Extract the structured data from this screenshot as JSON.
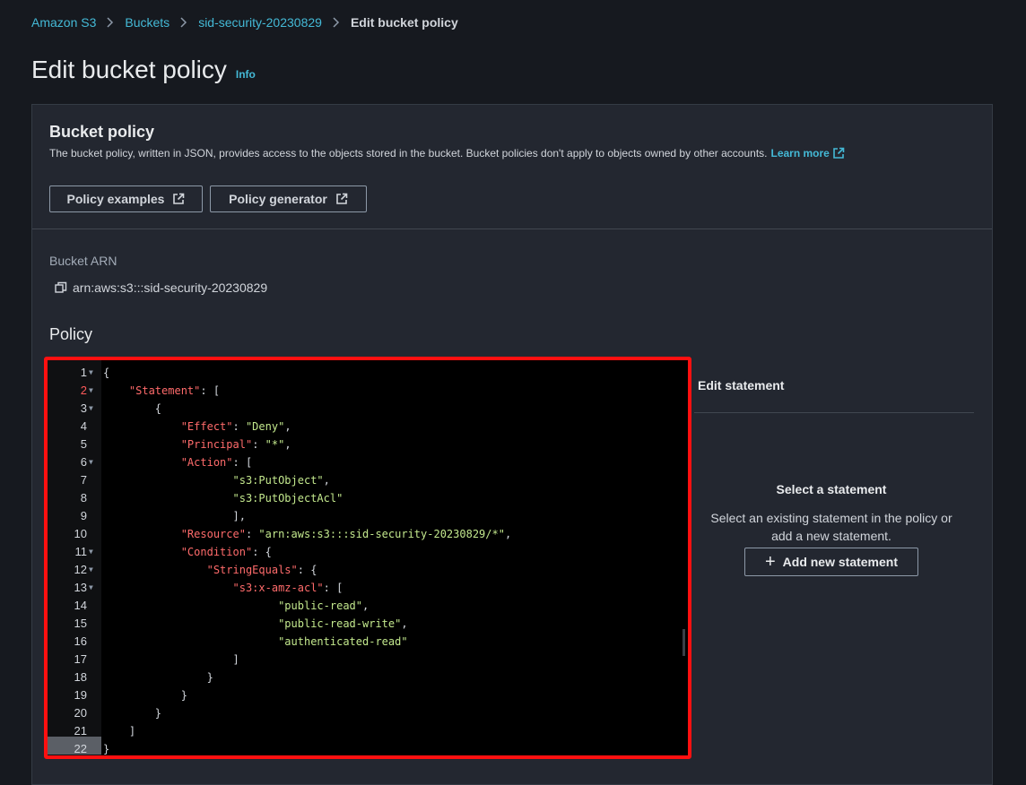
{
  "breadcrumb": {
    "items": [
      "Amazon S3",
      "Buckets",
      "sid-security-20230829"
    ],
    "current": "Edit bucket policy"
  },
  "page": {
    "title": "Edit bucket policy",
    "info_link": "Info"
  },
  "bucket_policy": {
    "title": "Bucket policy",
    "description": "The bucket policy, written in JSON, provides access to the objects stored in the bucket. Bucket policies don't apply to objects owned by other accounts.",
    "learn_more": "Learn more",
    "policy_examples_button": "Policy examples",
    "policy_generator_button": "Policy generator",
    "arn_label": "Bucket ARN",
    "arn_value": "arn:aws:s3:::sid-security-20230829",
    "policy_label": "Policy"
  },
  "editor": {
    "lines": [
      {
        "n": "1",
        "fold": true,
        "code": "{"
      },
      {
        "n": "2",
        "fold": true,
        "error": true,
        "code": "    \"Statement\": ["
      },
      {
        "n": "3",
        "fold": true,
        "code": "        {"
      },
      {
        "n": "4",
        "code": "            \"Effect\": \"Deny\","
      },
      {
        "n": "5",
        "code": "            \"Principal\": \"*\","
      },
      {
        "n": "6",
        "fold": true,
        "code": "            \"Action\": ["
      },
      {
        "n": "7",
        "code": "                    \"s3:PutObject\","
      },
      {
        "n": "8",
        "code": "                    \"s3:PutObjectAcl\""
      },
      {
        "n": "9",
        "code": "                    ],"
      },
      {
        "n": "10",
        "code": "            \"Resource\": \"arn:aws:s3:::sid-security-20230829/*\","
      },
      {
        "n": "11",
        "fold": true,
        "code": "            \"Condition\": {"
      },
      {
        "n": "12",
        "fold": true,
        "code": "                \"StringEquals\": {"
      },
      {
        "n": "13",
        "fold": true,
        "code": "                    \"s3:x-amz-acl\": ["
      },
      {
        "n": "14",
        "code": "                           \"public-read\","
      },
      {
        "n": "15",
        "code": "                           \"public-read-write\","
      },
      {
        "n": "16",
        "code": "                           \"authenticated-read\""
      },
      {
        "n": "17",
        "code": "                    ]"
      },
      {
        "n": "18",
        "code": "                }"
      },
      {
        "n": "19",
        "code": "            }"
      },
      {
        "n": "20",
        "code": "        }"
      },
      {
        "n": "21",
        "code": "    ]"
      },
      {
        "n": "22",
        "code": "}"
      }
    ]
  },
  "side": {
    "edit_statement": "Edit statement",
    "select_title": "Select a statement",
    "select_desc_line1": "Select an existing statement in the policy or",
    "select_desc_line2": "add a new statement.",
    "add_button": "Add new statement"
  },
  "colors": {
    "link": "#44b9d6",
    "highlight_border": "#ff1010",
    "json_key": "#ff6b6b",
    "json_string": "#c3e88d"
  }
}
